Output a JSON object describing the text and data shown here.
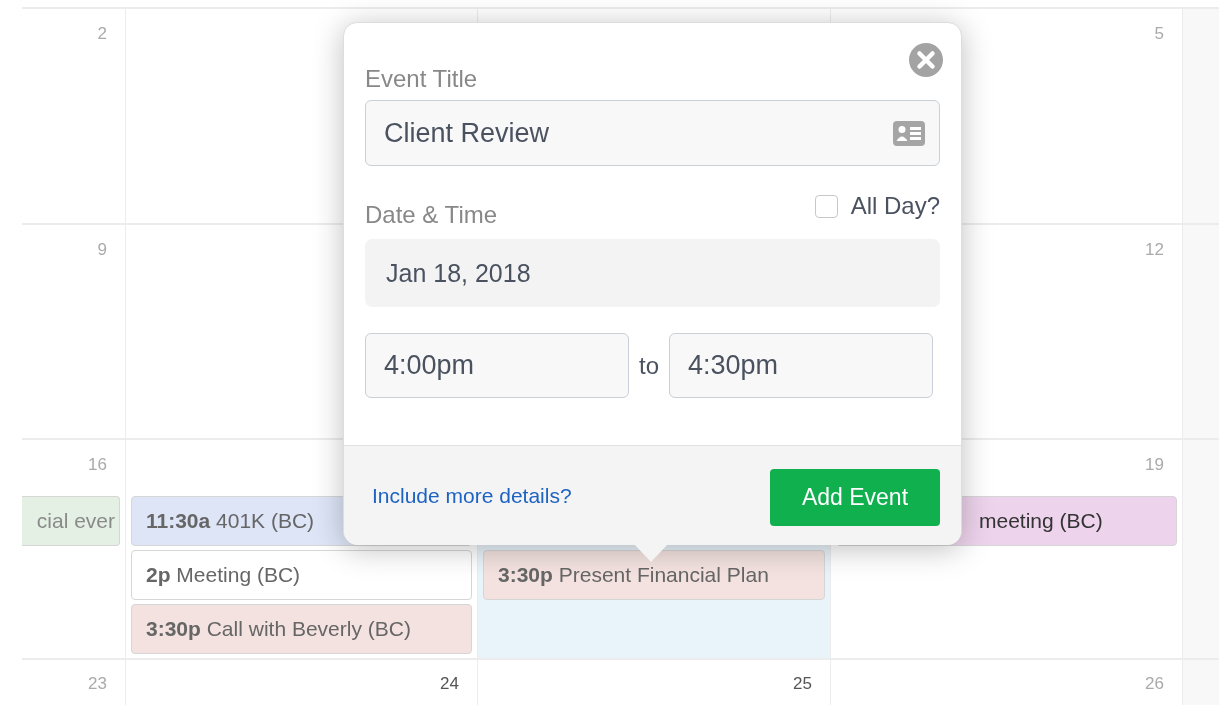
{
  "calendar": {
    "weeks": [
      {
        "days": [
          {
            "number": "2",
            "strong": false,
            "selected": false
          },
          {
            "selected": false
          },
          {
            "number": "5",
            "strong": false,
            "selected": false
          }
        ]
      },
      {
        "days": [
          {
            "number": "9",
            "strong": false,
            "selected": false
          },
          {
            "selected": false
          },
          {
            "number": "12",
            "strong": false,
            "selected": false
          }
        ]
      },
      {
        "days": [
          {
            "number": "16",
            "strong": false,
            "selected": false,
            "events": [
              {
                "title": "cial ever",
                "color": "#e3f0e3"
              }
            ]
          },
          {
            "selected": false,
            "events": [
              {
                "time": "11:30a",
                "title": "401K (BC)",
                "color": "#dde5f7"
              },
              {
                "time": "2p",
                "title": "Meeting (BC)",
                "color": "#ffffff"
              },
              {
                "time": "3:30p",
                "title": "Call with Beverly (BC)",
                "color": "#f3e2df"
              }
            ]
          },
          {
            "selected": true,
            "events": [
              {
                "time": "3:30p",
                "title": "Present Financial Plan",
                "color": "#f3e2df"
              }
            ]
          },
          {
            "number": "19",
            "strong": false,
            "selected": false,
            "events": [
              {
                "title": "meeting (BC)",
                "color": "#edd3ec"
              }
            ]
          }
        ]
      },
      {
        "days": [
          {
            "number": "23",
            "strong": false,
            "selected": false
          },
          {
            "number": "24",
            "strong": true,
            "selected": false
          },
          {
            "number": "25",
            "strong": true,
            "selected": false
          },
          {
            "number": "26",
            "strong": false,
            "selected": false
          }
        ]
      }
    ]
  },
  "popover": {
    "title_label": "Event Title",
    "title_value": "Client Review",
    "date_label": "Date & Time",
    "all_day": {
      "label": "All Day?",
      "checked": false
    },
    "date": "Jan 18, 2018",
    "start": "4:00pm",
    "separator": "to",
    "end": "4:30pm",
    "details_link": "Include more details?",
    "submit": "Add Event"
  }
}
